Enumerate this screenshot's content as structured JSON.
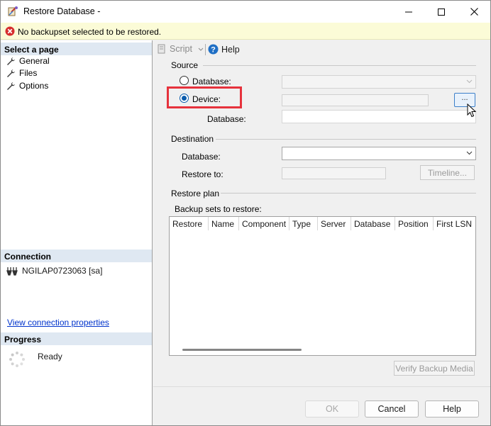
{
  "window": {
    "title": "Restore Database -",
    "icon": "restore-database-icon"
  },
  "message": {
    "text": "No backupset selected to be restored.",
    "icon": "error-icon",
    "color": "#d62d2d"
  },
  "left_panel": {
    "select_page_header": "Select a page",
    "pages": [
      {
        "label": "General",
        "icon": "wrench-icon"
      },
      {
        "label": "Files",
        "icon": "wrench-icon"
      },
      {
        "label": "Options",
        "icon": "wrench-icon"
      }
    ],
    "connection_header": "Connection",
    "connection_name": "NGILAP0723063 [sa]",
    "connection_link": "View connection properties",
    "progress_header": "Progress",
    "progress_status": "Ready"
  },
  "toolbar": {
    "script_label": "Script",
    "help_label": "Help"
  },
  "source": {
    "group_label": "Source",
    "database_radio_label": "Database:",
    "device_radio_label": "Device:",
    "device_selected": true,
    "browse_label": "...",
    "database_label": "Database:"
  },
  "destination": {
    "group_label": "Destination",
    "database_label": "Database:",
    "restore_to_label": "Restore to:",
    "timeline_label": "Timeline..."
  },
  "restore_plan": {
    "group_label": "Restore plan",
    "backup_sets_label": "Backup sets to restore:",
    "columns": [
      "Restore",
      "Name",
      "Component",
      "Type",
      "Server",
      "Database",
      "Position",
      "First LSN"
    ],
    "verify_label": "Verify Backup Media"
  },
  "buttons": {
    "ok": "OK",
    "cancel": "Cancel",
    "help": "Help"
  },
  "colors": {
    "accent": "#0b5cad",
    "highlight": "#e6323c",
    "section_header": "#dfe8f2",
    "message_bar": "#fbfbd7"
  }
}
